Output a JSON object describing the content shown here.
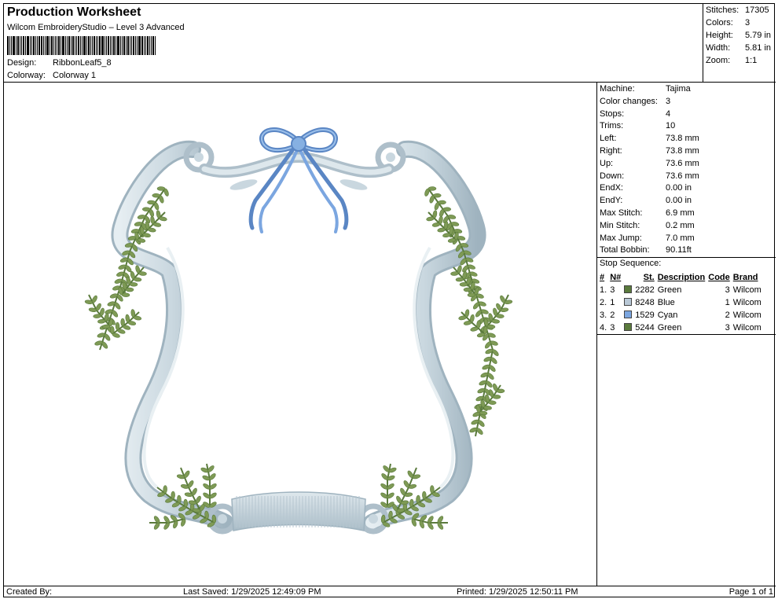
{
  "header": {
    "title": "Production Worksheet",
    "subtitle": "Wilcom EmbroideryStudio – Level 3 Advanced",
    "design_label": "Design:",
    "design_value": "RibbonLeaf5_8",
    "colorway_label": "Colorway:",
    "colorway_value": "Colorway 1"
  },
  "summary": {
    "stitches_label": "Stitches:",
    "stitches_value": "17305",
    "colors_label": "Colors:",
    "colors_value": "3",
    "height_label": "Height:",
    "height_value": "5.79 in",
    "width_label": "Width:",
    "width_value": "5.81 in",
    "zoom_label": "Zoom:",
    "zoom_value": "1:1"
  },
  "machine_info": [
    {
      "label": "Machine:",
      "value": "Tajima"
    },
    {
      "label": "Color changes:",
      "value": "3"
    },
    {
      "label": "Stops:",
      "value": "4"
    },
    {
      "label": "Trims:",
      "value": "10"
    },
    {
      "label": "Left:",
      "value": "73.8 mm"
    },
    {
      "label": "Right:",
      "value": "73.8 mm"
    },
    {
      "label": "Up:",
      "value": "73.6 mm"
    },
    {
      "label": "Down:",
      "value": "73.6 mm"
    },
    {
      "label": "EndX:",
      "value": "0.00 in"
    },
    {
      "label": "EndY:",
      "value": "0.00 in"
    },
    {
      "label": "Max Stitch:",
      "value": "6.9 mm"
    },
    {
      "label": "Min Stitch:",
      "value": "0.2 mm"
    },
    {
      "label": "Max Jump:",
      "value": "7.0 mm"
    },
    {
      "label": "Total Bobbin:",
      "value": "90.11ft"
    }
  ],
  "stop_sequence": {
    "title": "Stop Sequence:",
    "headers": {
      "num": "#",
      "needle": "N#",
      "st": "St.",
      "description": "Description",
      "code": "Code",
      "brand": "Brand"
    },
    "rows": [
      {
        "num": "1.",
        "needle": "3",
        "color": "#5a7a3c",
        "st": "2282",
        "description": "Green",
        "code": "3",
        "brand": "Wilcom"
      },
      {
        "num": "2.",
        "needle": "1",
        "color": "#b9c8d6",
        "st": "8248",
        "description": "Blue",
        "code": "1",
        "brand": "Wilcom"
      },
      {
        "num": "3.",
        "needle": "2",
        "color": "#7ba6e0",
        "st": "1529",
        "description": "Cyan",
        "code": "2",
        "brand": "Wilcom"
      },
      {
        "num": "4.",
        "needle": "3",
        "color": "#5a7a3c",
        "st": "5244",
        "description": "Green",
        "code": "3",
        "brand": "Wilcom"
      }
    ]
  },
  "footer": {
    "created_by": "Created By:",
    "last_saved": "Last Saved: 1/29/2025 12:49:09 PM",
    "printed": "Printed: 1/29/2025 12:50:11 PM",
    "page": "Page 1 of 1"
  },
  "colors": {
    "frame": "#c9d7df",
    "frame_shadow": "#9fb3bf",
    "leaf": "#7e9a55",
    "leaf_dark": "#5a7a3c",
    "bow": "#86b0e2",
    "bow_dark": "#5a86c4"
  }
}
